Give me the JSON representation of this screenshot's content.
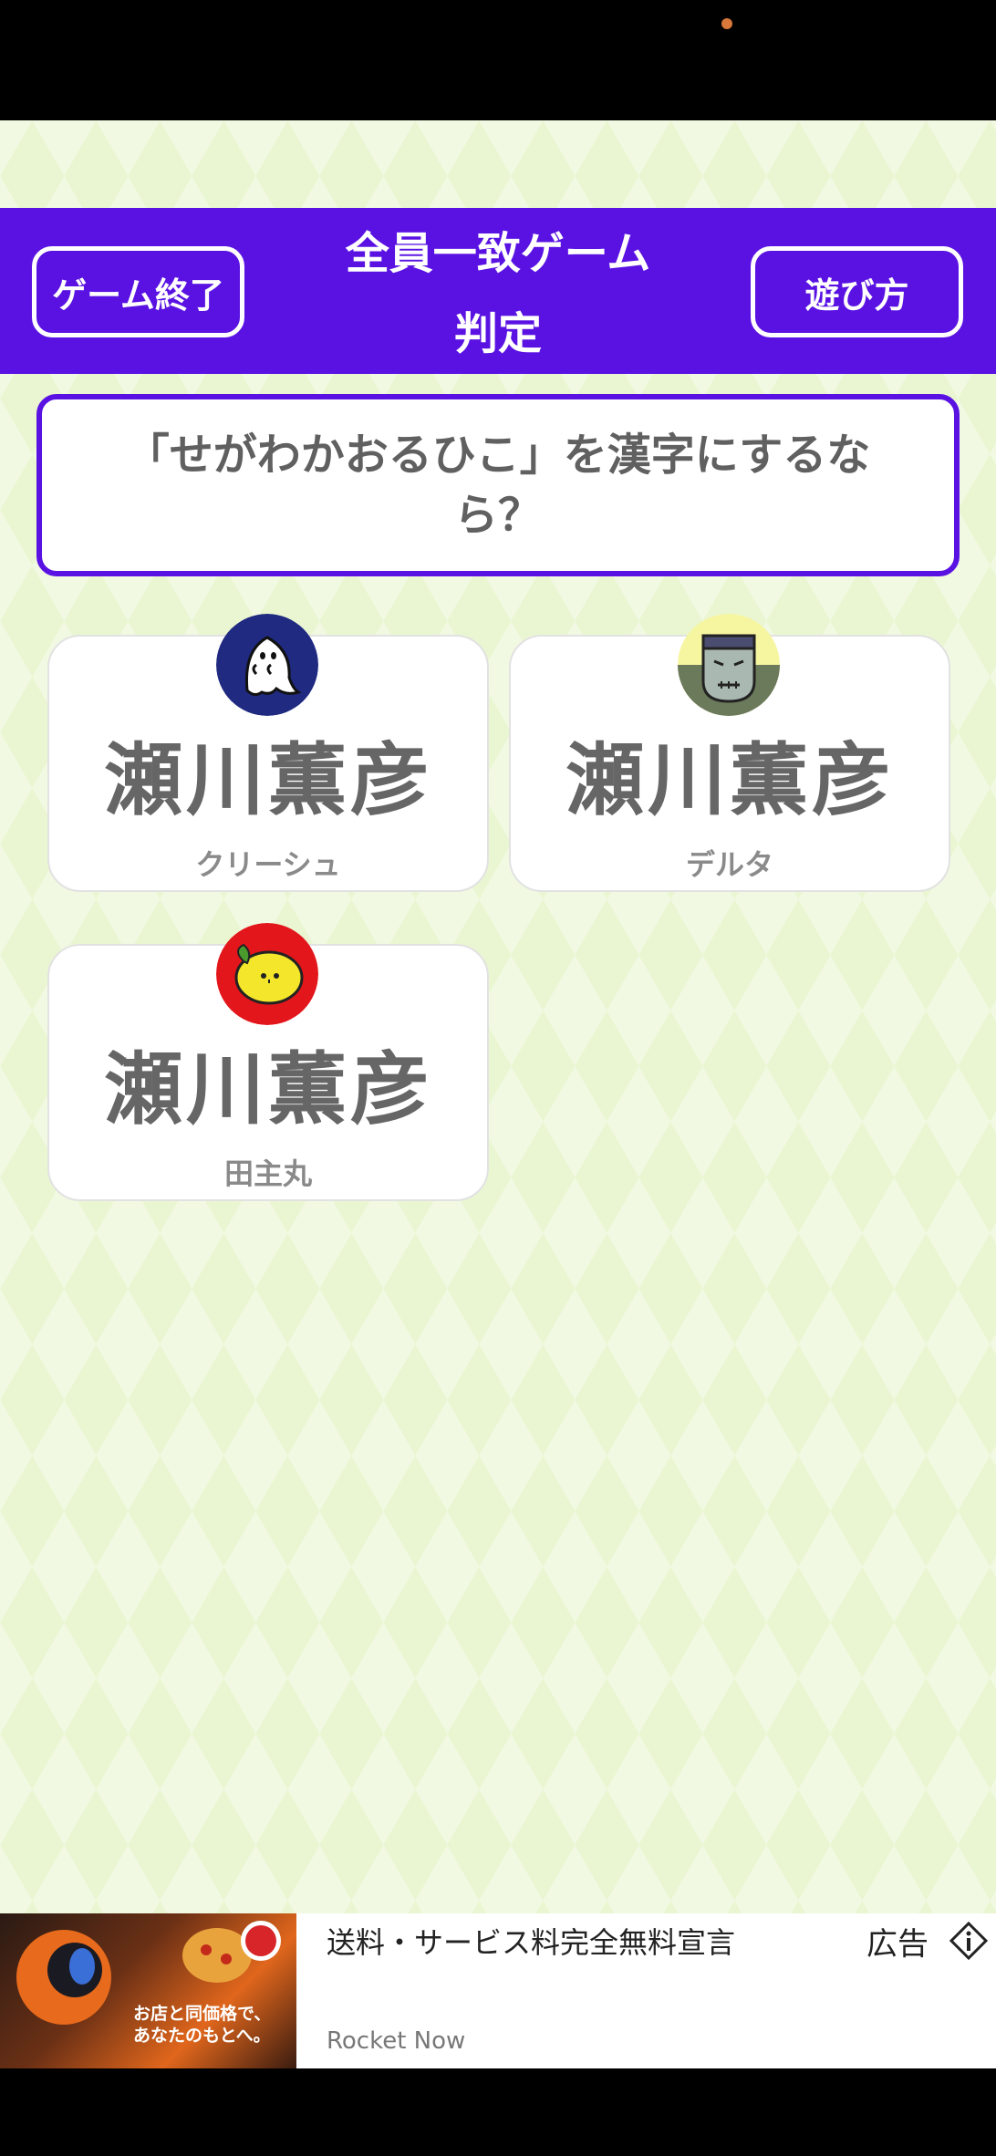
{
  "header": {
    "end_button": "ゲーム終了",
    "title_line1": "全員一致ゲーム",
    "title_line2": "判定",
    "howto_button": "遊び方"
  },
  "question": "「せがわかおるひこ」を漢字にするなら？",
  "answers": [
    {
      "answer": "瀬川薫彦",
      "player": "クリーシュ",
      "avatar_icon": "ghost-icon"
    },
    {
      "answer": "瀬川薫彦",
      "player": "デルタ",
      "avatar_icon": "frankenstein-icon"
    },
    {
      "answer": "瀬川薫彦",
      "player": "田主丸",
      "avatar_icon": "lemon-icon"
    }
  ],
  "ad": {
    "headline": "送料・サービス料完全無料宣言",
    "source": "Rocket Now",
    "label": "広告",
    "image_text_line1": "お店と同価格で、",
    "image_text_line2": "あなたのもとへ。"
  },
  "colors": {
    "accent": "#5a12e3",
    "background": "#eaf6d2",
    "answer_text": "#666666"
  }
}
